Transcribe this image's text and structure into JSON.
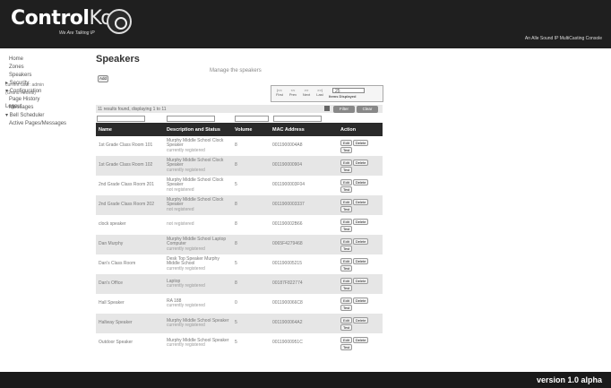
{
  "header": {
    "logo_main": "Control",
    "logo_accent": "Kom",
    "tagline": "We Are Talking IP",
    "right_text": "An Alle Sound IP MultiCasting Console"
  },
  "sidebar": {
    "items": [
      {
        "label": "Home",
        "indent": true
      },
      {
        "label": "Zones",
        "indent": true
      },
      {
        "label": "Speakers",
        "indent": true
      },
      {
        "label": "▸ Security",
        "indent": false
      },
      {
        "label": "▾ Configuration",
        "indent": false
      },
      {
        "label": "Page History",
        "indent": true
      },
      {
        "label": "Messages",
        "indent": true
      },
      {
        "label": "▾ Bell Scheduler",
        "indent": false
      },
      {
        "label": "Active Pages/Messages",
        "indent": true
      }
    ],
    "user_line1": "current user: admin",
    "user_line2": "(Grand Fedeal)",
    "logout": "Logout"
  },
  "page": {
    "title": "Speakers",
    "subtitle": "Manage the speakers",
    "add_label": "Add"
  },
  "pager": {
    "first": "|<<",
    "prev": "<<",
    "next": ">>",
    "last": ">>|",
    "first_label": "First",
    "prev_label": "Prev",
    "next_label": "Next",
    "last_label": "Last",
    "items_value": "25",
    "items_label": "Items Displayed"
  },
  "list": {
    "results_text": "11 results found, displaying 1 to 11",
    "filter_label": "Filter",
    "clear_label": "Clear",
    "columns": [
      "Name",
      "Description and Status",
      "Volume",
      "MAC Address",
      "Action"
    ],
    "edit_label": "Edit",
    "delete_label": "Delete",
    "test_label": "Test",
    "rows": [
      {
        "name": "1st Grade Class Room 101",
        "desc": "Murphy Middle School Clock Speaker",
        "status": "currently registered",
        "volume": "8",
        "mac": "0011900004A8"
      },
      {
        "name": "1st Grade Class Room 102",
        "desc": "Murphy Middle School Clock Speaker",
        "status": "currently registered",
        "volume": "8",
        "mac": "001190000904"
      },
      {
        "name": "2nd Grade Class Room 201",
        "desc": "Murphy Middle School Clock Speaker",
        "status": "not registered",
        "volume": "5",
        "mac": "0011900003F04"
      },
      {
        "name": "2nd Grade Class Room 202",
        "desc": "Murphy Middle School Clock Speaker",
        "status": "not registered",
        "volume": "8",
        "mac": "0011900003337"
      },
      {
        "name": "clock speaker",
        "desc": "",
        "status": "not registered",
        "volume": "8",
        "mac": "001190002B66"
      },
      {
        "name": "Dan Murphy",
        "desc": "Murphy Middle School Laptop Computer",
        "status": "currently registered",
        "volume": "8",
        "mac": "0065F4279468"
      },
      {
        "name": "Dan's Class Room",
        "desc": "Desk Top Speaker Murphy Middle School",
        "status": "currently registered",
        "volume": "5",
        "mac": "001190005215"
      },
      {
        "name": "Dan's Office",
        "desc": "Laptop",
        "status": "currently registered",
        "volume": "8",
        "mac": "00187F822774"
      },
      {
        "name": "Hall Speaker",
        "desc": "RA 188",
        "status": "currently registered",
        "volume": "0",
        "mac": "0011900066C8"
      },
      {
        "name": "Hallway Speaker",
        "desc": "Murphy Middle School Speaker",
        "status": "currently registered",
        "volume": "5",
        "mac": "0011900064A2"
      },
      {
        "name": "Outdoor Speaker",
        "desc": "Murphy Middle School Speaker",
        "status": "currently registered",
        "volume": "5",
        "mac": "00119000951C"
      }
    ]
  },
  "footer": {
    "version": "version 1.0 alpha"
  }
}
